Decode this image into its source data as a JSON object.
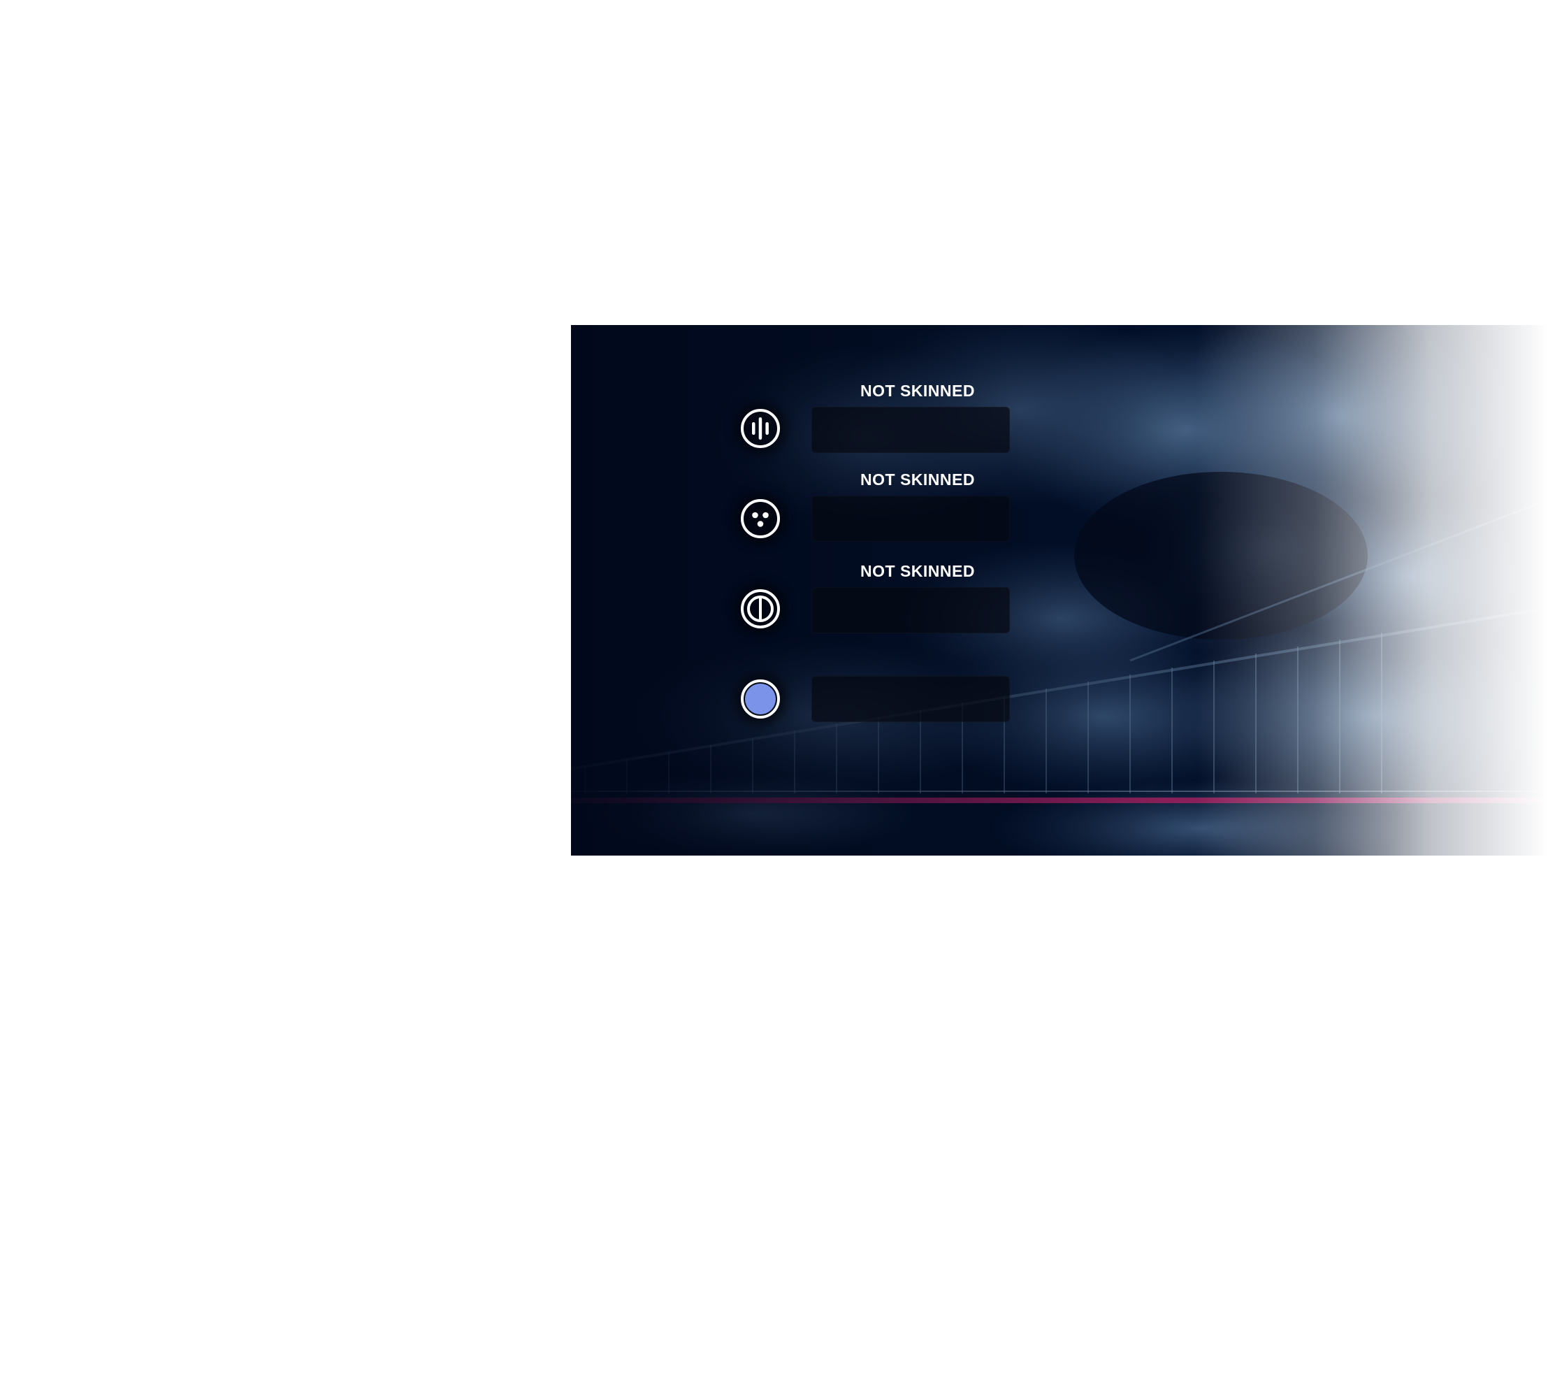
{
  "panel": {
    "colors": {
      "background": "#01081a",
      "foliage": "#3d5e85",
      "accent_line": "#b8236a",
      "selected_icon": "#7b93e8"
    },
    "slots": [
      {
        "label": "NOT SKINNED",
        "icon": "sound-bars-icon",
        "selected": false
      },
      {
        "label": "NOT SKINNED",
        "icon": "three-dots-icon",
        "selected": false
      },
      {
        "label": "NOT SKINNED",
        "icon": "split-circle-icon",
        "selected": false
      },
      {
        "label": "",
        "icon": "filled-circle-icon",
        "selected": true
      }
    ]
  }
}
